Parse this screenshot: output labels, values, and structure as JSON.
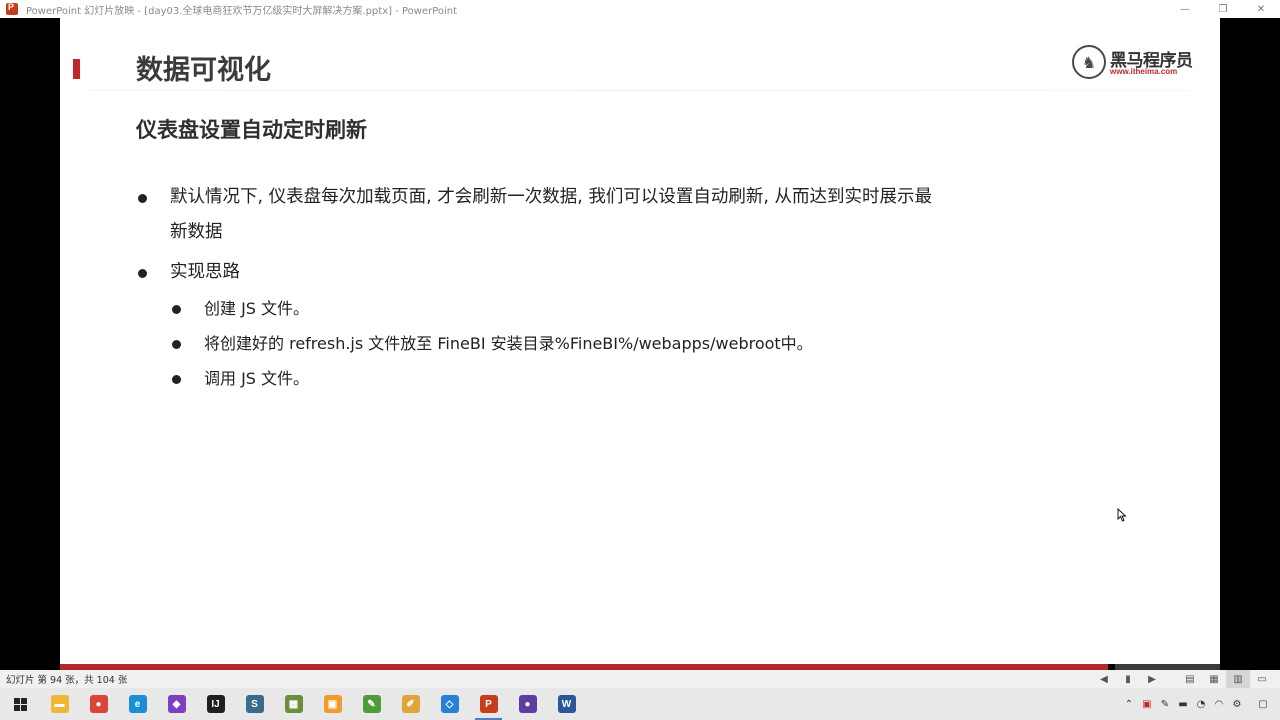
{
  "window": {
    "title": "PowerPoint 幻灯片放映 - [day03.全球电商狂欢节万亿级实时大屏解决方案.pptx] - PowerPoint",
    "app_icon": "powerpoint-icon",
    "controls": [
      "minimize-icon",
      "restore-icon",
      "close-icon"
    ]
  },
  "slide": {
    "section_title": "数据可视化",
    "logo": {
      "cn": "黑马程序员",
      "url": "www.itheima.com"
    },
    "subtitle": "仪表盘设置自动定时刷新",
    "bullets": [
      {
        "line1": "默认情况下, 仪表盘每次加载页面, 才会刷新一次数据, 我们可以设置自动刷新, 从而达到实时展示最",
        "line2": "新数据"
      },
      {
        "line1": "实现思路"
      }
    ],
    "sub_bullets": [
      "创建 JS 文件。",
      "将创建好的 refresh.js 文件放至 FineBI 安装目录%FineBI%/webapps/webroot中。",
      "调用 JS 文件。"
    ],
    "accent_color": "#c0282d"
  },
  "progress": {
    "current": 94,
    "total": 104
  },
  "statusbar": {
    "slide_counter": "幻灯片 第 94 张，共 104 张",
    "icons": [
      "prev-icon",
      "notes-icon",
      "next-icon",
      "normal-view-icon",
      "slide-sorter-icon",
      "reading-view-icon",
      "slideshow-icon"
    ]
  },
  "taskbar": {
    "apps": [
      {
        "name": "file-explorer-icon",
        "color": "#f2b632",
        "glyph": "▬"
      },
      {
        "name": "chrome-icon",
        "color": "#db4437",
        "glyph": "●"
      },
      {
        "name": "edge-icon",
        "color": "#1a8fd8",
        "glyph": "e"
      },
      {
        "name": "app-icon-purple",
        "color": "#7b3fbf",
        "glyph": "◆"
      },
      {
        "name": "intellij-icon",
        "color": "#1f1f1f",
        "glyph": "IJ"
      },
      {
        "name": "sublime-icon",
        "color": "#3a6a8c",
        "glyph": "S"
      },
      {
        "name": "photo-app-icon",
        "color": "#6b8f3a",
        "glyph": "▦"
      },
      {
        "name": "window-app-icon",
        "color": "#f19b2c",
        "glyph": "▣"
      },
      {
        "name": "notepad-icon",
        "color": "#4f9a3a",
        "glyph": "✎"
      },
      {
        "name": "pencil-app-icon",
        "color": "#e0a43a",
        "glyph": "✐"
      },
      {
        "name": "network-app-icon",
        "color": "#2a7fd9",
        "glyph": "◇"
      },
      {
        "name": "powerpoint-taskbar-icon",
        "color": "#c43e1c",
        "glyph": "P"
      },
      {
        "name": "browser-orb-icon",
        "color": "#5a3fa0",
        "glyph": "●"
      },
      {
        "name": "word-icon",
        "color": "#2b579a",
        "glyph": "W"
      }
    ],
    "active_app_index": 11,
    "tray_icons": [
      "chevron-up-icon",
      "tray-app-icon",
      "pen-icon",
      "battery-icon",
      "volume-icon",
      "wifi-icon",
      "settings-icon",
      "notification-icon"
    ]
  }
}
